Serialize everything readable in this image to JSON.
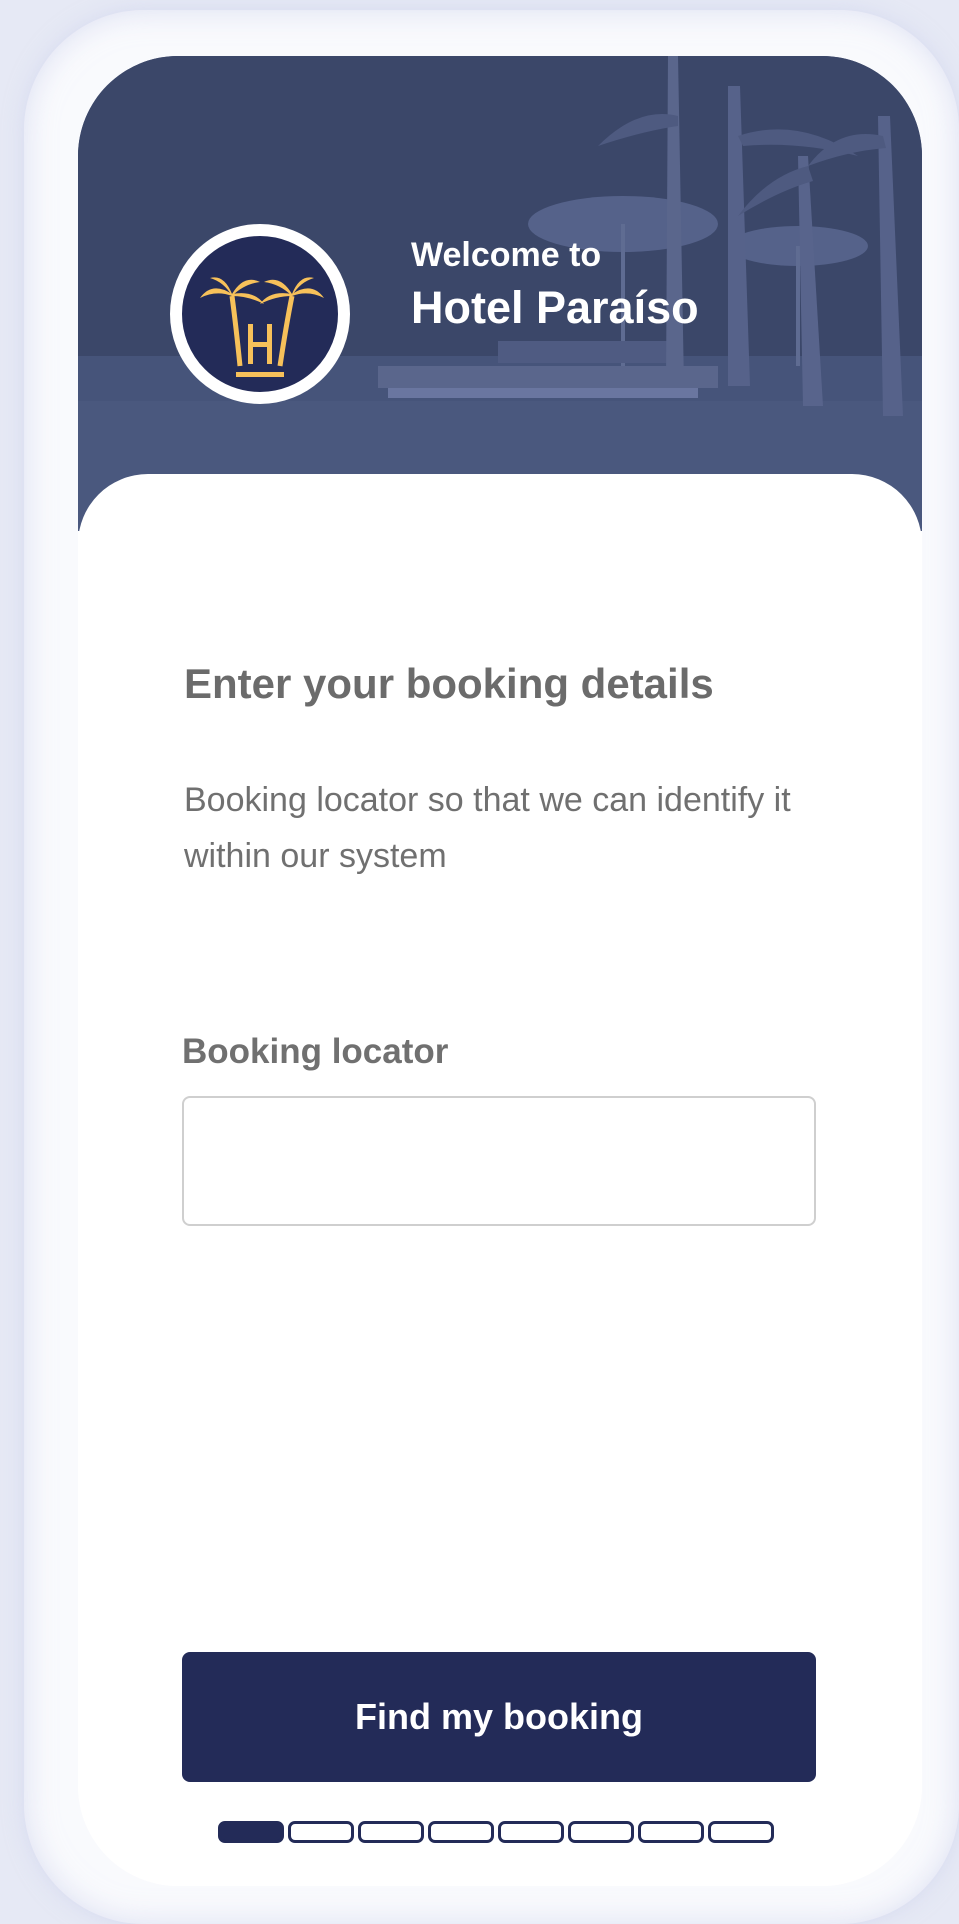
{
  "header": {
    "welcome_line": "Welcome to",
    "hotel_name": "Hotel Paraíso",
    "logo_icon": "palm-trees-hotel-logo",
    "background": "pool-with-palms-photo"
  },
  "form": {
    "heading": "Enter your booking details",
    "description": "Booking locator so that we can identify it within our system",
    "locator_label": "Booking locator",
    "locator_value": "",
    "locator_placeholder": ""
  },
  "actions": {
    "find_label": "Find my booking"
  },
  "progress": {
    "current_step": 1,
    "total_steps": 8
  },
  "colors": {
    "primary": "#232b58",
    "hero_overlay": "#3d4a6e",
    "logo_accent": "#f7c15a",
    "text_muted": "#6b6b6b"
  }
}
